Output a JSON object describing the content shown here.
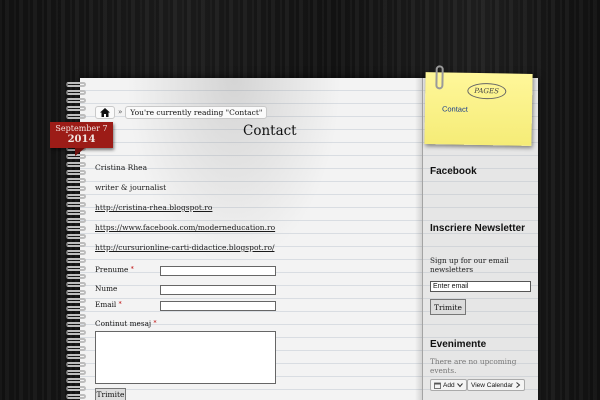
{
  "breadcrumb": {
    "home_icon": "home-icon",
    "separator": "»",
    "current_text": "You're currently reading \"Contact\""
  },
  "page": {
    "title": "Contact"
  },
  "date_ribbon": {
    "month_day": "September 7",
    "year": "2014"
  },
  "content": {
    "name": "Cristina Rhea",
    "role": "writer & journalist",
    "link1": "http://cristina-rhea.blogspot.ro",
    "link2": "https://www.facebook.com/moderneducation.ro",
    "link3": "http://cursurionline-carti-didactice.blogspot.ro/"
  },
  "form": {
    "prenume_label": "Prenume",
    "nume_label": "Nume",
    "email_label": "Email",
    "message_label": "Continut mesaj",
    "required_mark": "*",
    "submit_label": "Trimite"
  },
  "sticky_note": {
    "logo_text": "PAGES",
    "link": "Contact"
  },
  "sidebar": {
    "facebook_heading": "Facebook",
    "newsletter_heading": "Inscriere Newsletter",
    "newsletter_text": "Sign up for our email newsletters",
    "email_placeholder": "Enter email",
    "newsletter_button": "Trimite",
    "events_heading": "Evenimente",
    "events_text": "There are no upcoming events.",
    "add_button": "Add",
    "view_calendar_button": "View Calendar",
    "arrow_icon": "chevron-down-icon",
    "next_icon": "chevron-right-icon"
  },
  "colors": {
    "ribbon": "#9c1c17",
    "sticky": "#fff79a",
    "link_blue": "#1a3d8a"
  }
}
